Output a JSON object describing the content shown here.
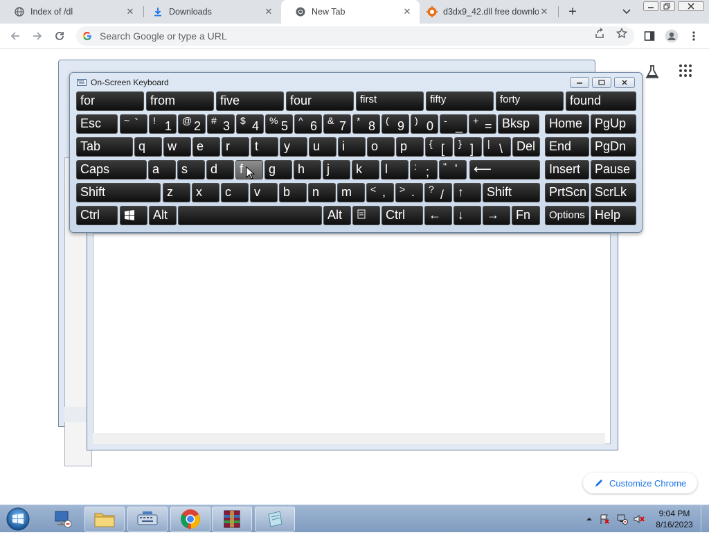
{
  "browser": {
    "tabs": [
      {
        "label": "Index of /dl",
        "active": false,
        "icon": "globe-icon"
      },
      {
        "label": "Downloads",
        "active": false,
        "icon": "download-icon"
      },
      {
        "label": "New Tab",
        "active": true,
        "icon": "chrome-icon"
      },
      {
        "label": "d3dx9_42.dll free downlo",
        "active": false,
        "icon": "gear-orange-icon"
      }
    ],
    "new_tab_symbol": "+",
    "tab_close_symbol": "✕",
    "omnibox_placeholder": "Search Google or type a URL",
    "customize_label": "Customize Chrome"
  },
  "osk": {
    "title": "On-Screen Keyboard",
    "predictions": [
      "for",
      "from",
      "five",
      "four",
      "first",
      "fifty",
      "forty",
      "found"
    ],
    "row1": {
      "esc": "Esc",
      "keys": [
        {
          "shift": "~",
          "main": "`"
        },
        {
          "shift": "!",
          "main": "1"
        },
        {
          "shift": "@",
          "main": "2"
        },
        {
          "shift": "#",
          "main": "3"
        },
        {
          "shift": "$",
          "main": "4"
        },
        {
          "shift": "%",
          "main": "5"
        },
        {
          "shift": "^",
          "main": "6"
        },
        {
          "shift": "&",
          "main": "7"
        },
        {
          "shift": "*",
          "main": "8"
        },
        {
          "shift": "(",
          "main": "9"
        },
        {
          "shift": ")",
          "main": "0"
        },
        {
          "shift": "-",
          "main": "_"
        },
        {
          "shift": "+",
          "main": "="
        }
      ],
      "bksp": "Bksp",
      "home": "Home",
      "pgup": "PgUp"
    },
    "row2": {
      "tab": "Tab",
      "letters": [
        "q",
        "w",
        "e",
        "r",
        "t",
        "y",
        "u",
        "i",
        "o",
        "p"
      ],
      "brackets": [
        {
          "shift": "{",
          "main": "["
        },
        {
          "shift": "}",
          "main": "]"
        },
        {
          "shift": "|",
          "main": "\\"
        }
      ],
      "del": "Del",
      "end": "End",
      "pgdn": "PgDn"
    },
    "row3": {
      "caps": "Caps",
      "letters": [
        "a",
        "s",
        "d",
        "f",
        "g",
        "h",
        "j",
        "k",
        "l"
      ],
      "punct": [
        {
          "shift": ":",
          "main": ";"
        },
        {
          "shift": "\"",
          "main": "'"
        }
      ],
      "enter_symbol": "⟵",
      "insert": "Insert",
      "pause": "Pause"
    },
    "row4": {
      "shift": "Shift",
      "letters": [
        "z",
        "x",
        "c",
        "v",
        "b",
        "n",
        "m"
      ],
      "punct": [
        {
          "shift": "<",
          "main": ","
        },
        {
          "shift": ">",
          "main": "."
        },
        {
          "shift": "?",
          "main": "/"
        }
      ],
      "up": "↑",
      "shift_right": "Shift",
      "prtscn": "PrtScn",
      "scrlk": "ScrLk"
    },
    "row5": {
      "ctrl": "Ctrl",
      "alt": "Alt",
      "alt_right": "Alt",
      "ctrl_right": "Ctrl",
      "left": "←",
      "down": "↓",
      "right": "→",
      "fn": "Fn",
      "options": "Options",
      "help": "Help"
    }
  },
  "taskbar": {
    "time": "9:04 PM",
    "date": "8/16/2023"
  }
}
